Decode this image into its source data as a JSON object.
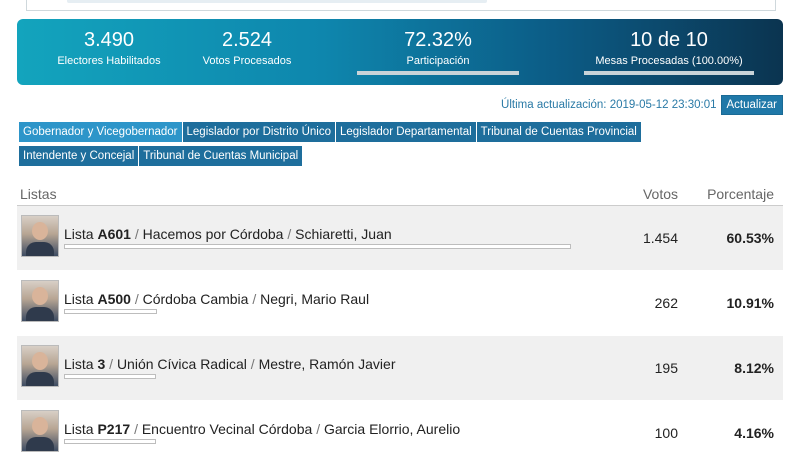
{
  "stats": {
    "electores": {
      "value": "3.490",
      "label": "Electores Habilitados"
    },
    "votos": {
      "value": "2.524",
      "label": "Votos Procesados"
    },
    "participacion": {
      "value": "72.32%",
      "label": "Participación",
      "fraction": 0.7232
    },
    "mesas": {
      "value": "10 de 10",
      "label": "Mesas Procesadas (100.00%)",
      "fraction": 1.0
    }
  },
  "update": {
    "text": "Última actualización: 2019-05-12 23:30:01",
    "button": "Actualizar"
  },
  "tabs": [
    {
      "label": "Gobernador y Vicegobernador",
      "active": true
    },
    {
      "label": "Legislador por Distrito Único"
    },
    {
      "label": "Legislador Departamental"
    },
    {
      "label": "Tribunal de Cuentas Provincial"
    },
    {
      "label": "Intendente y Concejal"
    },
    {
      "label": "Tribunal de Cuentas Municipal"
    }
  ],
  "table": {
    "headers": {
      "listas": "Listas",
      "votos": "Votos",
      "porcentaje": "Porcentaje"
    },
    "rows": [
      {
        "prefix": "Lista",
        "code": "A601",
        "party": "Hacemos por Córdoba",
        "candidate": "Schiaretti, Juan",
        "votes": "1.454",
        "percent": "60.53%",
        "share": 0.6053
      },
      {
        "prefix": "Lista",
        "code": "A500",
        "party": "Córdoba Cambia",
        "candidate": "Negri, Mario Raul",
        "votes": "262",
        "percent": "10.91%",
        "share": 0.1091
      },
      {
        "prefix": "Lista",
        "code": "3",
        "party": "Unión Cívica Radical",
        "candidate": "Mestre, Ramón Javier",
        "votes": "195",
        "percent": "8.12%",
        "share": 0.0812
      },
      {
        "prefix": "Lista",
        "code": "P217",
        "party": "Encuentro Vecinal Córdoba",
        "candidate": "Garcia Elorrio, Aurelio",
        "votes": "100",
        "percent": "4.16%",
        "share": 0.0416
      }
    ],
    "separator": "/"
  },
  "colors": {
    "accent": "#1e6e9c",
    "active_tab": "#2d95c9",
    "link": "#2a7aa6"
  }
}
